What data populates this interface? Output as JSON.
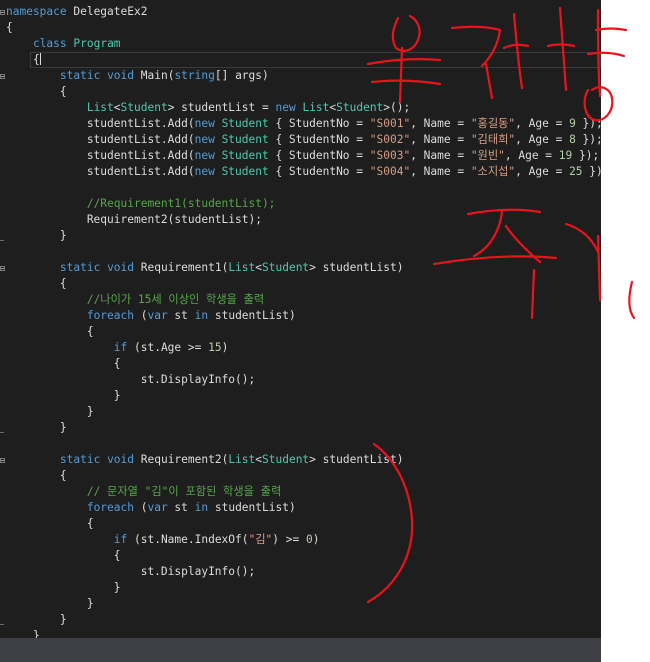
{
  "editor": {
    "language": "C#",
    "colors": {
      "background": "#1e1e1e",
      "plain": "#dcdcdc",
      "keyword": "#569cd6",
      "type": "#4ec9b0",
      "string": "#d69d85",
      "comment": "#57a64a",
      "number": "#b5cea8",
      "annotation_ink": "#e8141c"
    },
    "lines": [
      [
        {
          "c": "k",
          "t": "namespace"
        },
        {
          "c": "p",
          "t": " DelegateEx2"
        }
      ],
      [
        {
          "c": "p",
          "t": "{"
        }
      ],
      [
        {
          "c": "p",
          "t": "    "
        },
        {
          "c": "k",
          "t": "class"
        },
        {
          "c": "p",
          "t": " "
        },
        {
          "c": "t",
          "t": "Program"
        }
      ],
      [
        {
          "c": "p",
          "t": "    {"
        }
      ],
      [
        {
          "c": "p",
          "t": "        "
        },
        {
          "c": "k",
          "t": "static"
        },
        {
          "c": "p",
          "t": " "
        },
        {
          "c": "k",
          "t": "void"
        },
        {
          "c": "p",
          "t": " Main("
        },
        {
          "c": "k",
          "t": "string"
        },
        {
          "c": "p",
          "t": "[] args)"
        }
      ],
      [
        {
          "c": "p",
          "t": "        {"
        }
      ],
      [
        {
          "c": "p",
          "t": "            "
        },
        {
          "c": "t",
          "t": "List"
        },
        {
          "c": "p",
          "t": "<"
        },
        {
          "c": "t",
          "t": "Student"
        },
        {
          "c": "p",
          "t": "> studentList = "
        },
        {
          "c": "k",
          "t": "new"
        },
        {
          "c": "p",
          "t": " "
        },
        {
          "c": "t",
          "t": "List"
        },
        {
          "c": "p",
          "t": "<"
        },
        {
          "c": "t",
          "t": "Student"
        },
        {
          "c": "p",
          "t": ">();"
        }
      ],
      [
        {
          "c": "p",
          "t": "            studentList.Add("
        },
        {
          "c": "k",
          "t": "new"
        },
        {
          "c": "p",
          "t": " "
        },
        {
          "c": "t",
          "t": "Student"
        },
        {
          "c": "p",
          "t": " { StudentNo = "
        },
        {
          "c": "s",
          "t": "\"S001\""
        },
        {
          "c": "p",
          "t": ", Name = "
        },
        {
          "c": "s",
          "t": "\"홍길동\""
        },
        {
          "c": "p",
          "t": ", Age = "
        },
        {
          "c": "n",
          "t": "9"
        },
        {
          "c": "p",
          "t": " });"
        }
      ],
      [
        {
          "c": "p",
          "t": "            studentList.Add("
        },
        {
          "c": "k",
          "t": "new"
        },
        {
          "c": "p",
          "t": " "
        },
        {
          "c": "t",
          "t": "Student"
        },
        {
          "c": "p",
          "t": " { StudentNo = "
        },
        {
          "c": "s",
          "t": "\"S002\""
        },
        {
          "c": "p",
          "t": ", Name = "
        },
        {
          "c": "s",
          "t": "\"김태희\""
        },
        {
          "c": "p",
          "t": ", Age = "
        },
        {
          "c": "n",
          "t": "8"
        },
        {
          "c": "p",
          "t": " });"
        }
      ],
      [
        {
          "c": "p",
          "t": "            studentList.Add("
        },
        {
          "c": "k",
          "t": "new"
        },
        {
          "c": "p",
          "t": " "
        },
        {
          "c": "t",
          "t": "Student"
        },
        {
          "c": "p",
          "t": " { StudentNo = "
        },
        {
          "c": "s",
          "t": "\"S003\""
        },
        {
          "c": "p",
          "t": ", Name = "
        },
        {
          "c": "s",
          "t": "\"원빈\""
        },
        {
          "c": "p",
          "t": ", Age = "
        },
        {
          "c": "n",
          "t": "19"
        },
        {
          "c": "p",
          "t": " });"
        }
      ],
      [
        {
          "c": "p",
          "t": "            studentList.Add("
        },
        {
          "c": "k",
          "t": "new"
        },
        {
          "c": "p",
          "t": " "
        },
        {
          "c": "t",
          "t": "Student"
        },
        {
          "c": "p",
          "t": " { StudentNo = "
        },
        {
          "c": "s",
          "t": "\"S004\""
        },
        {
          "c": "p",
          "t": ", Name = "
        },
        {
          "c": "s",
          "t": "\"소지섭\""
        },
        {
          "c": "p",
          "t": ", Age = "
        },
        {
          "c": "n",
          "t": "25"
        },
        {
          "c": "p",
          "t": " });"
        }
      ],
      [
        {
          "c": "p",
          "t": ""
        }
      ],
      [
        {
          "c": "p",
          "t": "            "
        },
        {
          "c": "c",
          "t": "//Requirement1(studentList);"
        }
      ],
      [
        {
          "c": "p",
          "t": "            Requirement2(studentList);"
        }
      ],
      [
        {
          "c": "p",
          "t": "        }"
        }
      ],
      [
        {
          "c": "p",
          "t": ""
        }
      ],
      [
        {
          "c": "p",
          "t": "        "
        },
        {
          "c": "k",
          "t": "static"
        },
        {
          "c": "p",
          "t": " "
        },
        {
          "c": "k",
          "t": "void"
        },
        {
          "c": "p",
          "t": " Requirement1("
        },
        {
          "c": "t",
          "t": "List"
        },
        {
          "c": "p",
          "t": "<"
        },
        {
          "c": "t",
          "t": "Student"
        },
        {
          "c": "p",
          "t": "> studentList)"
        }
      ],
      [
        {
          "c": "p",
          "t": "        {"
        }
      ],
      [
        {
          "c": "p",
          "t": "            "
        },
        {
          "c": "c",
          "t": "//나이가 15세 이상인 학생을 출력"
        }
      ],
      [
        {
          "c": "p",
          "t": "            "
        },
        {
          "c": "k",
          "t": "foreach"
        },
        {
          "c": "p",
          "t": " ("
        },
        {
          "c": "k",
          "t": "var"
        },
        {
          "c": "p",
          "t": " st "
        },
        {
          "c": "k",
          "t": "in"
        },
        {
          "c": "p",
          "t": " studentList)"
        }
      ],
      [
        {
          "c": "p",
          "t": "            {"
        }
      ],
      [
        {
          "c": "p",
          "t": "                "
        },
        {
          "c": "k",
          "t": "if"
        },
        {
          "c": "p",
          "t": " (st.Age >= "
        },
        {
          "c": "n",
          "t": "15"
        },
        {
          "c": "p",
          "t": ")"
        }
      ],
      [
        {
          "c": "p",
          "t": "                {"
        }
      ],
      [
        {
          "c": "p",
          "t": "                    st.DisplayInfo();"
        }
      ],
      [
        {
          "c": "p",
          "t": "                }"
        }
      ],
      [
        {
          "c": "p",
          "t": "            }"
        }
      ],
      [
        {
          "c": "p",
          "t": "        }"
        }
      ],
      [
        {
          "c": "p",
          "t": ""
        }
      ],
      [
        {
          "c": "p",
          "t": "        "
        },
        {
          "c": "k",
          "t": "static"
        },
        {
          "c": "p",
          "t": " "
        },
        {
          "c": "k",
          "t": "void"
        },
        {
          "c": "p",
          "t": " Requirement2("
        },
        {
          "c": "t",
          "t": "List"
        },
        {
          "c": "p",
          "t": "<"
        },
        {
          "c": "t",
          "t": "Student"
        },
        {
          "c": "p",
          "t": "> studentList)"
        }
      ],
      [
        {
          "c": "p",
          "t": "        {"
        }
      ],
      [
        {
          "c": "p",
          "t": "            "
        },
        {
          "c": "c",
          "t": "// 문자열 \"김\"이 포함된 학생을 출력"
        }
      ],
      [
        {
          "c": "p",
          "t": "            "
        },
        {
          "c": "k",
          "t": "foreach"
        },
        {
          "c": "p",
          "t": " ("
        },
        {
          "c": "k",
          "t": "var"
        },
        {
          "c": "p",
          "t": " st "
        },
        {
          "c": "k",
          "t": "in"
        },
        {
          "c": "p",
          "t": " studentList)"
        }
      ],
      [
        {
          "c": "p",
          "t": "            {"
        }
      ],
      [
        {
          "c": "p",
          "t": "                "
        },
        {
          "c": "k",
          "t": "if"
        },
        {
          "c": "p",
          "t": " (st.Name.IndexOf("
        },
        {
          "c": "s",
          "t": "\"김\""
        },
        {
          "c": "p",
          "t": ") >= "
        },
        {
          "c": "n",
          "t": "0"
        },
        {
          "c": "p",
          "t": ")"
        }
      ],
      [
        {
          "c": "p",
          "t": "                {"
        }
      ],
      [
        {
          "c": "p",
          "t": "                    st.DisplayInfo();"
        }
      ],
      [
        {
          "c": "p",
          "t": "                }"
        }
      ],
      [
        {
          "c": "p",
          "t": "            }"
        }
      ],
      [
        {
          "c": "p",
          "t": "        }"
        }
      ],
      [
        {
          "c": "p",
          "t": "    }"
        }
      ]
    ],
    "current_line": 3,
    "fold_markers": [
      {
        "line": 0,
        "kind": "open"
      },
      {
        "line": 4,
        "kind": "open"
      },
      {
        "line": 14,
        "kind": "end"
      },
      {
        "line": 16,
        "kind": "open"
      },
      {
        "line": 26,
        "kind": "end"
      },
      {
        "line": 28,
        "kind": "open"
      },
      {
        "line": 38,
        "kind": "end"
      }
    ]
  },
  "annotations": {
    "note": "Red handwritten marks drawn over the screenshot: one near the top-right, one across the right middle, and a large bracket beside Requirement2."
  }
}
